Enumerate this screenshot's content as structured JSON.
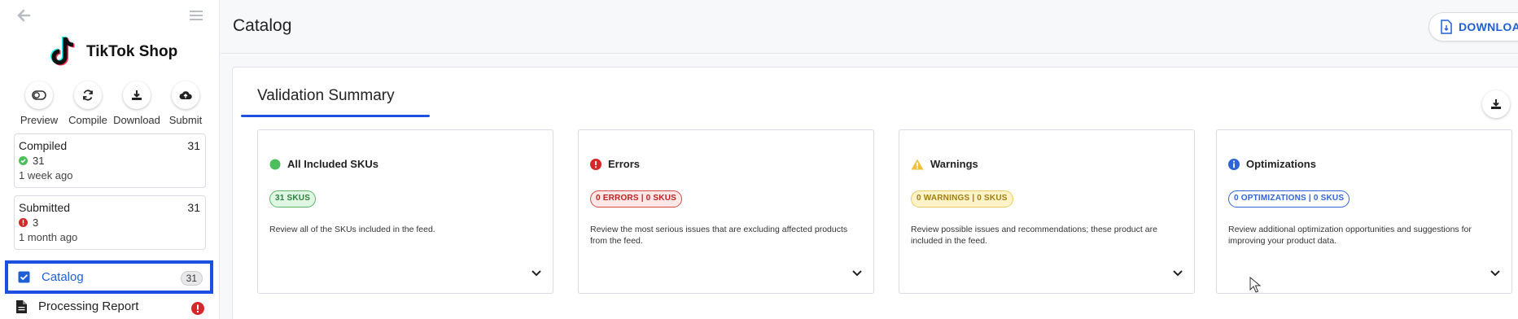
{
  "sidebar": {
    "brand": "TikTok Shop",
    "actions": [
      {
        "label": "Preview",
        "icon": "toggle-icon"
      },
      {
        "label": "Compile",
        "icon": "sync-icon"
      },
      {
        "label": "Download",
        "icon": "download-icon"
      },
      {
        "label": "Submit",
        "icon": "cloud-upload-icon"
      }
    ],
    "compiled": {
      "title": "Compiled",
      "count": "31",
      "value": "31",
      "time": "1 week ago"
    },
    "submitted": {
      "title": "Submitted",
      "count": "31",
      "value": "3",
      "time": "1 month ago"
    },
    "nav": {
      "catalog": {
        "label": "Catalog",
        "badge": "31"
      },
      "processing_report": {
        "label": "Processing Report"
      }
    }
  },
  "header": {
    "title": "Catalog",
    "download_label": "DOWNLOAD"
  },
  "validation": {
    "title": "Validation Summary",
    "cards": [
      {
        "title": "All Included SKUs",
        "pill": "31 SKUS",
        "desc": "Review all of the SKUs included in the feed.",
        "color": "#4cbf5b"
      },
      {
        "title": "Errors",
        "pill": "0 ERRORS | 0 SKUS",
        "desc": "Review the most serious issues that are excluding affected products from the feed.",
        "color": "#d62828"
      },
      {
        "title": "Warnings",
        "pill": "0 WARNINGS | 0 SKUS",
        "desc": "Review possible issues and recommendations; these product are included in the feed.",
        "color": "#f0c23a"
      },
      {
        "title": "Optimizations",
        "pill": "0 OPTIMIZATIONS | 0 SKUS",
        "desc": "Review additional optimization opportunities and suggestions for improving your product data.",
        "color": "#2f64d8"
      }
    ]
  },
  "colors": {
    "accent": "#1f4fe0",
    "link": "#1f5fd6"
  }
}
